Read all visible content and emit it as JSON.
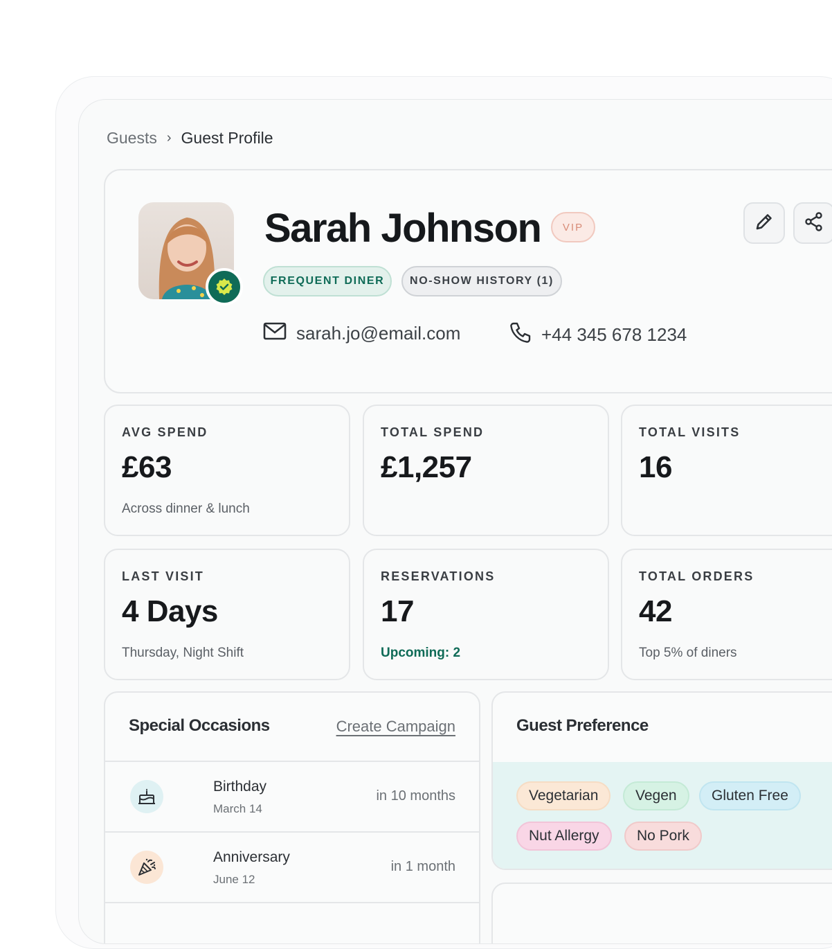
{
  "breadcrumb": {
    "parent": "Guests",
    "separator": "›",
    "current": "Guest Profile"
  },
  "profile": {
    "name": "Sarah Johnson",
    "badge": "VIP",
    "tags": [
      "FREQUENT DINER",
      "NO-SHOW HISTORY (1)"
    ],
    "email": "sarah.jo@email.com",
    "phone": "+44 345 678 1234"
  },
  "stats": [
    {
      "label": "AVG SPEND",
      "value": "£63",
      "sub": "Across dinner & lunch"
    },
    {
      "label": "TOTAL SPEND",
      "value": "£1,257",
      "sub": ""
    },
    {
      "label": "TOTAL VISITS",
      "value": "16",
      "sub": ""
    },
    {
      "label": "LAST VISIT",
      "value": "4 Days",
      "sub": "Thursday, Night Shift"
    },
    {
      "label": "RESERVATIONS",
      "value": "17",
      "sub": "Upcoming: 2"
    },
    {
      "label": "TOTAL ORDERS",
      "value": "42",
      "sub": "Top 5% of diners"
    }
  ],
  "occasions": {
    "title": "Special Occasions",
    "action": "Create Campaign",
    "items": [
      {
        "name": "Birthday",
        "date": "March 14",
        "when": "in 10 months",
        "icon": "cake-icon"
      },
      {
        "name": "Anniversary",
        "date": "June 12",
        "when": "in 1 month",
        "icon": "party-popper-icon"
      }
    ]
  },
  "preferences": {
    "title": "Guest Preference",
    "chips": [
      "Vegetarian",
      "Vegen",
      "Gluten Free",
      "Nut Allergy",
      "No Pork"
    ]
  },
  "colors": {
    "accent": "#0f6b57",
    "vip": "#d88c78",
    "chip_vegetarian": "#fbe8d6",
    "chip_vegen": "#d6f2e4",
    "chip_gluten": "#d3eef6",
    "chip_nut": "#f9d6e6",
    "chip_pork": "#f8dcdc"
  }
}
